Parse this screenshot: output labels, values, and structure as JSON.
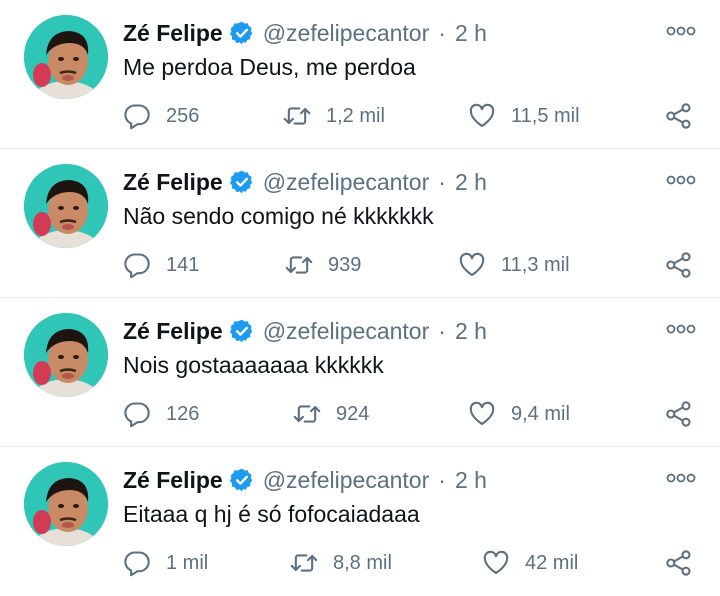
{
  "colors": {
    "text": "#0f1419",
    "secondary": "#5b7083",
    "verified": "#1d9bf0",
    "divider": "#e6ecf0",
    "avatar_bg": "#2fc6b8"
  },
  "icons": {
    "verified": "verified-badge-icon",
    "more": "more-options-icon",
    "reply": "reply-icon",
    "retweet": "retweet-icon",
    "like": "heart-icon",
    "share": "share-icon"
  },
  "tweets": [
    {
      "name": "Zé Felipe",
      "handle": "@zefelipecantor",
      "separator": "·",
      "time": "2 h",
      "text": "Me perdoa Deus, me perdoa",
      "replies": "256",
      "retweets": "1,2 mil",
      "likes": "11,5 mil"
    },
    {
      "name": "Zé Felipe",
      "handle": "@zefelipecantor",
      "separator": "·",
      "time": "2 h",
      "text": "Não sendo comigo né kkkkkkk",
      "replies": "141",
      "retweets": "939",
      "likes": "11,3 mil"
    },
    {
      "name": "Zé Felipe",
      "handle": "@zefelipecantor",
      "separator": "·",
      "time": "2 h",
      "text": "Nois gostaaaaaaa kkkkkk",
      "replies": "126",
      "retweets": "924",
      "likes": "9,4 mil"
    },
    {
      "name": "Zé Felipe",
      "handle": "@zefelipecantor",
      "separator": "·",
      "time": "2 h",
      "text": "Eitaaa q hj é só fofocaiadaaa",
      "replies": "1 mil",
      "retweets": "8,8 mil",
      "likes": "42 mil"
    }
  ]
}
